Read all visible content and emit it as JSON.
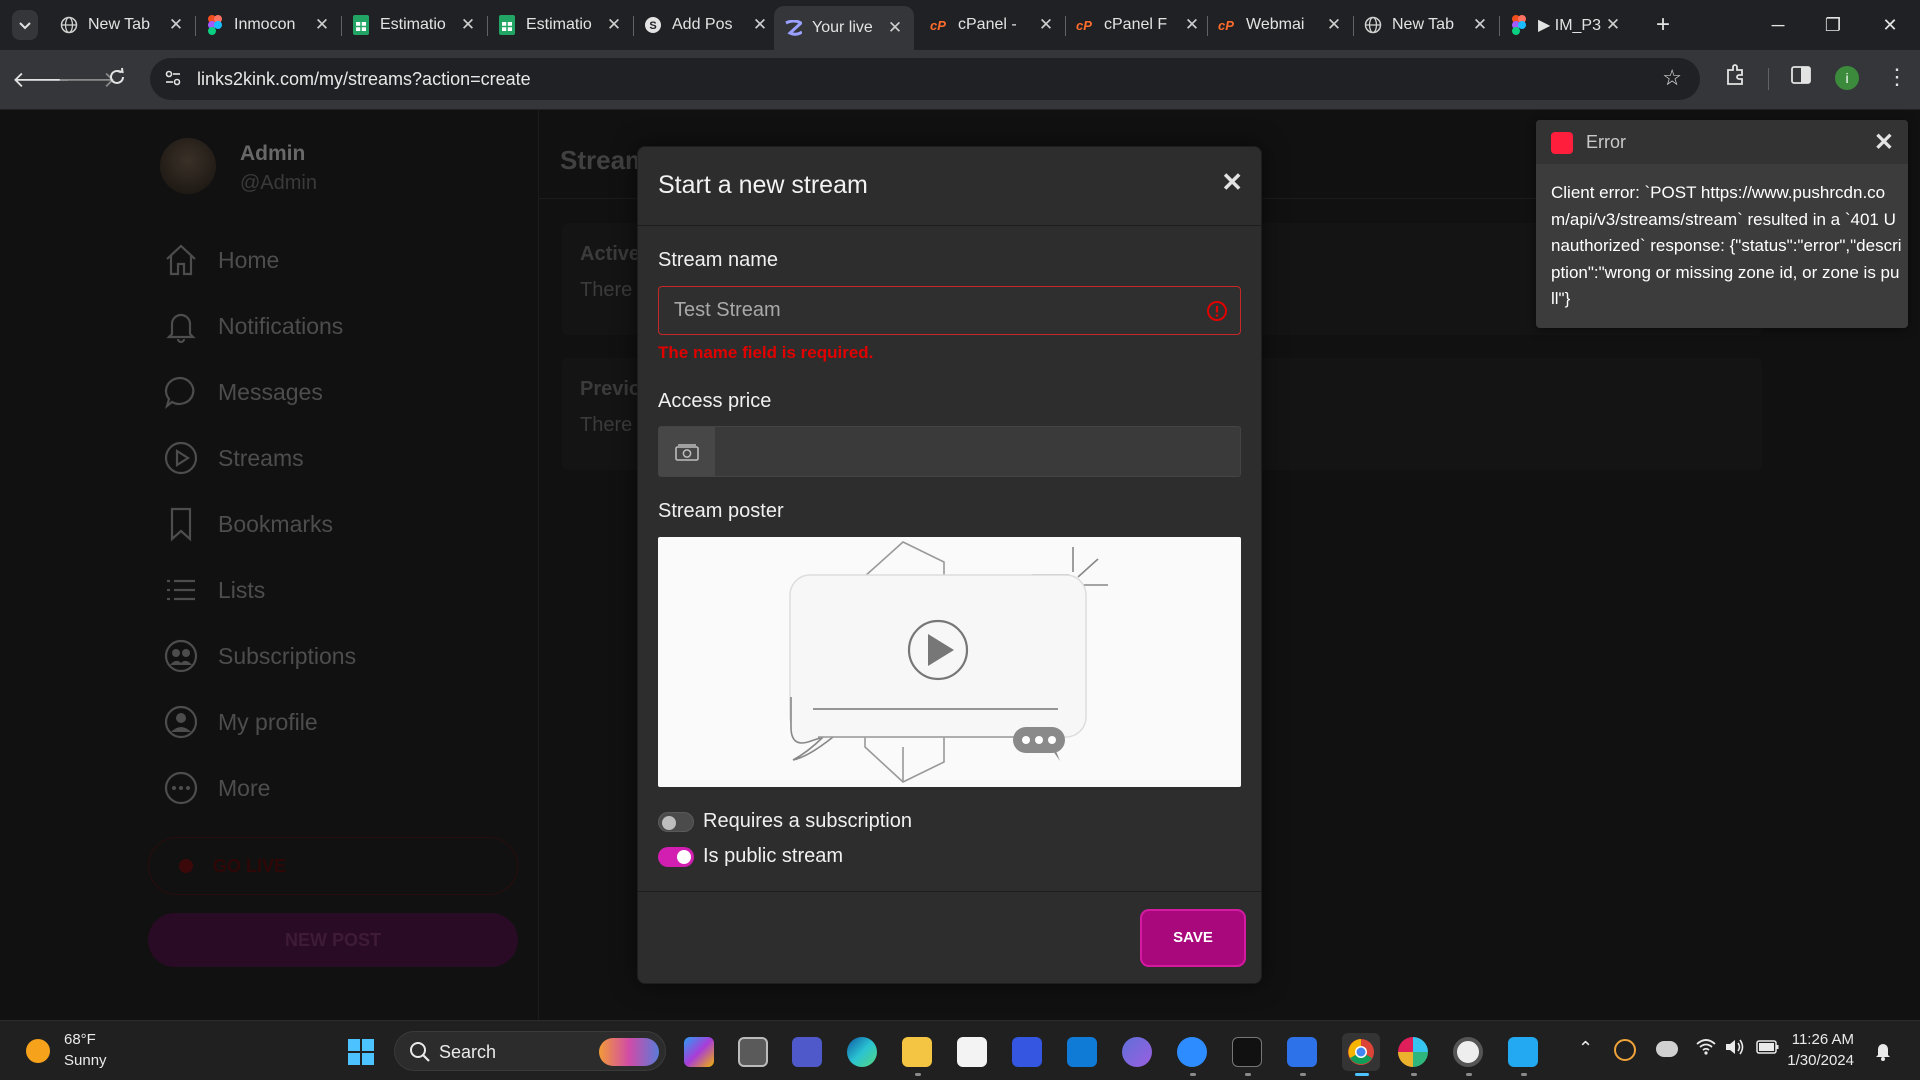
{
  "browser": {
    "tabs": [
      {
        "title": "New Tab",
        "icon": "globe-icon"
      },
      {
        "title": "Inmocon",
        "icon": "figma-icon"
      },
      {
        "title": "Estimatio",
        "icon": "sheets-icon"
      },
      {
        "title": "Estimatio",
        "icon": "sheets-icon"
      },
      {
        "title": "Add Pos",
        "icon": "add-post-icon"
      },
      {
        "title": "Your live",
        "icon": "site-icon",
        "active": true
      },
      {
        "title": "cPanel -",
        "icon": "cpanel-icon"
      },
      {
        "title": "cPanel F",
        "icon": "cpanel-icon"
      },
      {
        "title": "Webmai",
        "icon": "cpanel-icon"
      },
      {
        "title": "New Tab",
        "icon": "globe-icon"
      },
      {
        "title": "▶ IM_P3",
        "icon": "figma-icon"
      }
    ],
    "url": "links2kink.com/my/streams?action=create"
  },
  "sidebar": {
    "user_name": "Admin",
    "user_handle": "@Admin",
    "items": [
      {
        "label": "Home",
        "icon": "home-icon"
      },
      {
        "label": "Notifications",
        "icon": "bell-icon"
      },
      {
        "label": "Messages",
        "icon": "chat-icon"
      },
      {
        "label": "Streams",
        "icon": "play-circle-icon"
      },
      {
        "label": "Bookmarks",
        "icon": "bookmark-icon"
      },
      {
        "label": "Lists",
        "icon": "list-icon"
      },
      {
        "label": "Subscriptions",
        "icon": "subscriptions-icon"
      },
      {
        "label": "My profile",
        "icon": "user-circle-icon"
      },
      {
        "label": "More",
        "icon": "more-icon"
      }
    ],
    "go_live": "GO LIVE",
    "new_post": "NEW POST"
  },
  "main": {
    "title": "Stream",
    "active_heading": "Active",
    "active_text": "There",
    "previous_heading": "Previo",
    "previous_text": "There"
  },
  "modal": {
    "title": "Start a new stream",
    "stream_name_label": "Stream name",
    "stream_name_value": "Test Stream",
    "name_error": "The name field is required.",
    "access_price_label": "Access price",
    "access_price_value": "",
    "poster_label": "Stream poster",
    "requires_subscription_label": "Requires a subscription",
    "requires_subscription": false,
    "public_stream_label": "Is public stream",
    "public_stream": true,
    "save_label": "SAVE"
  },
  "toast": {
    "title": "Error",
    "message": "Client error: `POST https://www.pushrcdn.com/api/v3/streams/stream` resulted in a `401 Unauthorized` response: {\"status\":\"error\",\"description\":\"wrong or missing zone id, or zone is pull\"}"
  },
  "taskbar": {
    "temperature": "68°F",
    "condition": "Sunny",
    "search_label": "Search",
    "time": "11:26 AM",
    "date": "1/30/2024"
  },
  "colors": {
    "accent": "#a8087c",
    "error": "#e00000",
    "toast_error": "#ff1f3d"
  }
}
